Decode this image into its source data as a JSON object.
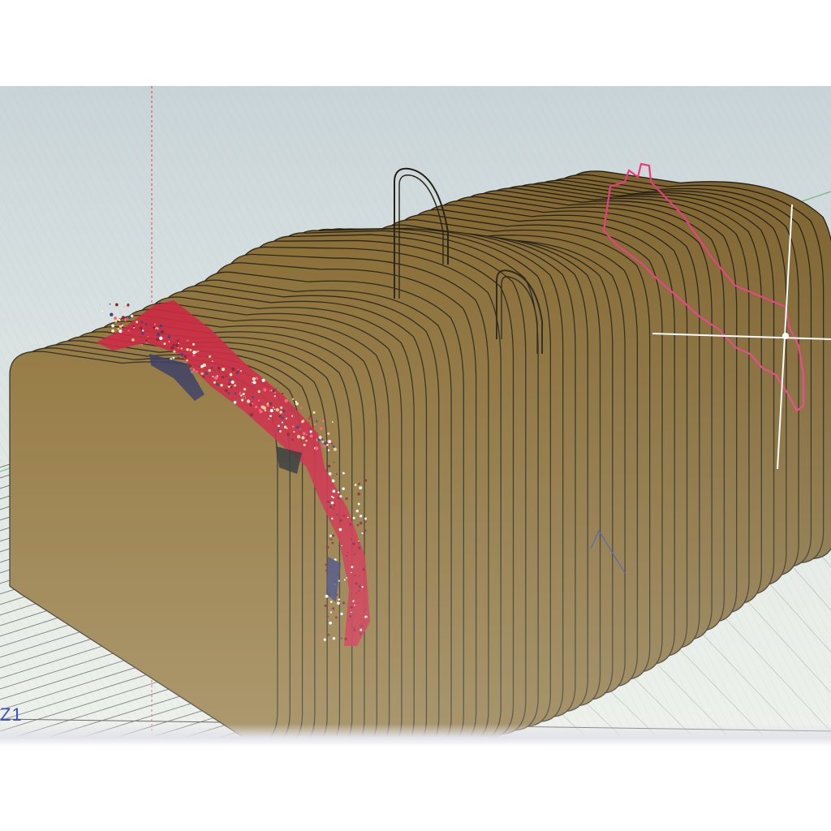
{
  "viewport": {
    "axis_label": "Z1",
    "colors": {
      "background_top": "#c9d4d8",
      "background_bottom": "#eef1ec",
      "slice_fill": "#8a6a2c",
      "slice_outline": "#1a1408",
      "grid_line": "#1c1c1c",
      "selection_highlight": "#e8327a",
      "pointcloud_primary": "#c8102e",
      "axis_red": "#e04040",
      "axis_green": "#4caf50",
      "crosshair": "#ffffff"
    },
    "icons": {
      "crosshair": "crosshair-cursor-icon",
      "gizmo": "axis-gizmo-icon"
    },
    "model": {
      "type": "sliced-3d-model",
      "highlighted_slice": "selected-cross-section",
      "scan_overlay": "point-cloud-scan"
    }
  }
}
